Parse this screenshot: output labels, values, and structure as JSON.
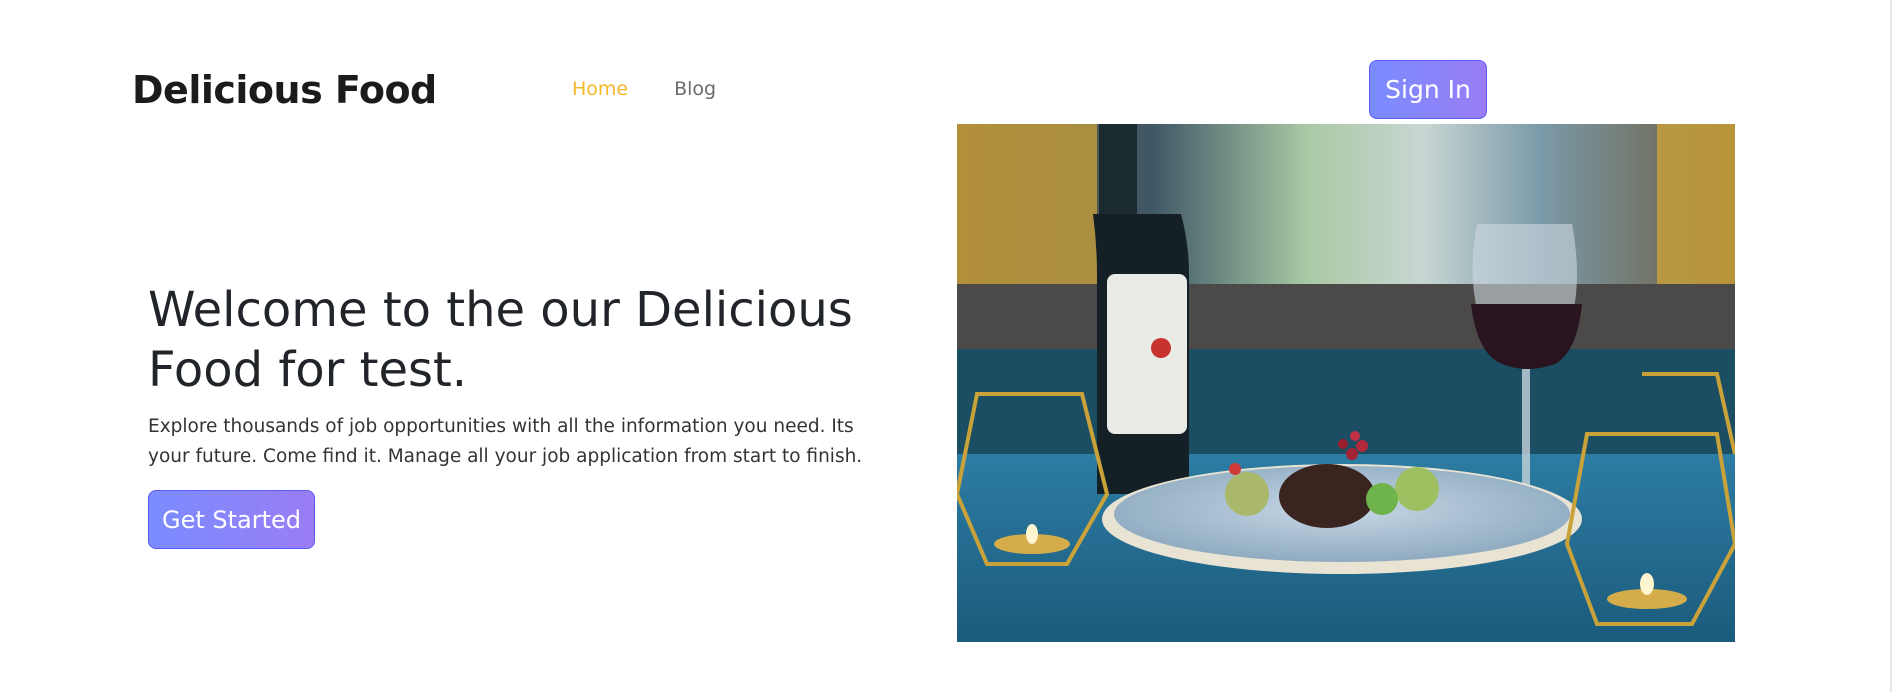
{
  "header": {
    "brand": "Delicious Food",
    "nav": [
      {
        "label": "Home",
        "active": true
      },
      {
        "label": "Blog",
        "active": false
      }
    ],
    "signin_label": "Sign In"
  },
  "hero": {
    "title": "Welcome to the our Delicious Food for test.",
    "description": "Explore thousands of job opportunities with all the information you need. Its your future. Come find it. Manage all your job application from start to finish.",
    "cta_label": "Get Started"
  },
  "colors": {
    "accent": "#f5b829",
    "button_start": "#7a8cff",
    "button_end": "#9a7df5"
  }
}
